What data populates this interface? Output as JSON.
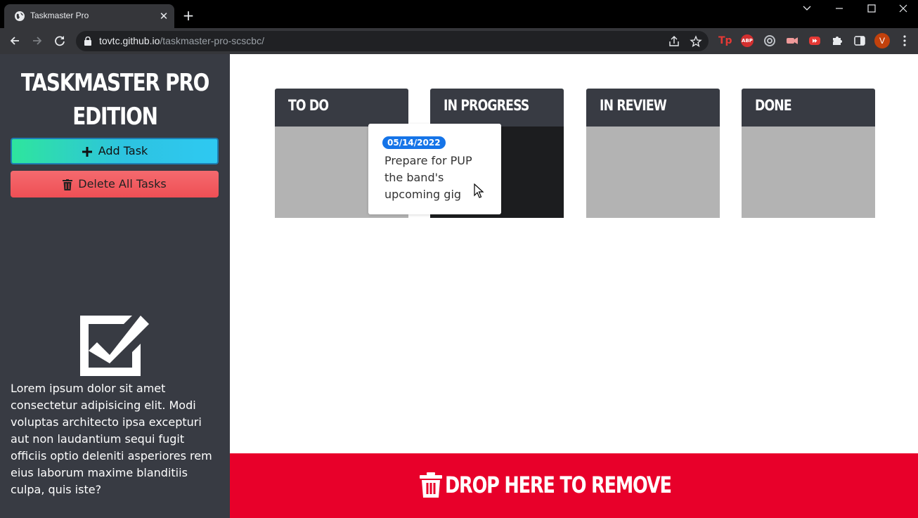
{
  "browser": {
    "tab_title": "Taskmaster Pro",
    "tab_close": "✕",
    "new_tab": "+",
    "url_domain": "tovtc.github.io",
    "url_path": "/taskmaster-pro-scscbc/",
    "avatar_letter": "V",
    "extensions": [
      {
        "name": "tp-extension-icon",
        "label": "Tp",
        "color": "#e53935"
      },
      {
        "name": "adblock-plus-icon",
        "label": "ABP",
        "color": "#d32f2f"
      },
      {
        "name": "openai-extension-icon",
        "label": "",
        "color": "#9aa0a6"
      },
      {
        "name": "video-extension-icon",
        "label": "",
        "color": "#e57373"
      },
      {
        "name": "youtube-extension-icon",
        "label": "",
        "color": "#e53935"
      }
    ]
  },
  "sidebar": {
    "title_line1": "TASKMASTER PRO",
    "title_line2": "EDITION",
    "add_task_label": "Add Task",
    "delete_all_label": "Delete All Tasks",
    "description": "Lorem ipsum dolor sit amet consectetur adipisicing elit. Modi voluptas architecto ipsa excepturi aut non laudantium sequi fugit officiis optio deleniti asperiores rem eius laborum maxime blanditiis culpa, quis iste?"
  },
  "board": {
    "columns": [
      {
        "title": "TO DO"
      },
      {
        "title": "IN PROGRESS"
      },
      {
        "title": "IN REVIEW"
      },
      {
        "title": "DONE"
      }
    ],
    "dragging_task": {
      "date": "05/14/2022",
      "text": "Prepare for PUP the band's upcoming gig"
    },
    "remove_zone_label": "DROP HERE TO REMOVE"
  },
  "colors": {
    "sidebar_bg": "#383b43",
    "column_header_bg": "#383b43",
    "column_body_bg": "#b3b3b3",
    "active_column_bg": "#1c1d1f",
    "date_badge": "#1574e8",
    "remove_zone_bg": "#e8002a",
    "add_gradient_start": "#2ee59d",
    "add_gradient_end": "#2ec9f2",
    "delete_bg": "#ef4f55"
  }
}
